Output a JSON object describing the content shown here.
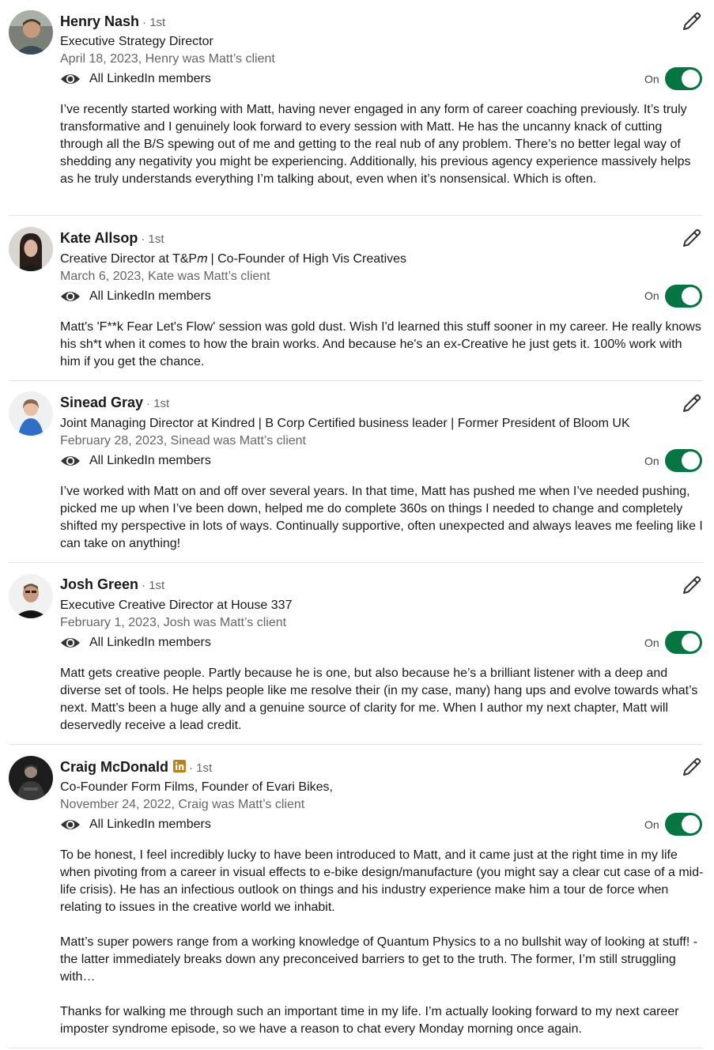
{
  "colors": {
    "toggle_on": "#057642",
    "divider": "#e3e3e3",
    "secondary_text": "#666666",
    "linkedin_badge": "#c37d16"
  },
  "recommendations": [
    {
      "name": "Henry Nash",
      "degree": "· 1st",
      "headline": "Executive Strategy Director",
      "date": "April 18, 2023, Henry was Matt’s client",
      "visibility": "All LinkedIn members",
      "toggle_label": "On",
      "toggle_state": true,
      "paragraphs": [
        " I’ve recently started working with Matt, having never engaged in any form of career coaching previously. It’s truly transformative and I genuinely look forward to every session with Matt. He has the uncanny knack of cutting through all the B/S spewing out of me and getting to the real nub of any problem. There’s no better legal way of shedding any negativity you might be experiencing. Additionally, his previous agency experience massively helps as he truly understands everything I’m talking about, even when it’s nonsensical. Which is often."
      ]
    },
    {
      "name": "Kate Allsop",
      "degree": "· 1st",
      "headline": "Creative Director at T&P𝑚 | Co-Founder of High Vis Creatives",
      "date": "March 6, 2023, Kate was Matt’s client",
      "visibility": "All LinkedIn members",
      "toggle_label": "On",
      "toggle_state": true,
      "paragraphs": [
        "Matt's 'F**k Fear Let's Flow' session was gold dust. Wish I'd learned this stuff sooner in my career. He really knows his sh*t when it comes to how the brain works. And because he's an ex-Creative he just gets it. 100% work with him if you get the chance."
      ]
    },
    {
      "name": "Sinead Gray",
      "degree": "· 1st",
      "headline": "Joint Managing Director at Kindred | B Corp Certified business leader | Former President of Bloom UK",
      "date": "February 28, 2023, Sinead was Matt’s client",
      "visibility": "All LinkedIn members",
      "toggle_label": "On",
      "toggle_state": true,
      "paragraphs": [
        "I’ve worked with Matt on and off over several years. In that time, Matt has pushed me when I’ve needed pushing, picked me up when I’ve been down, helped me do complete 360s on things I needed to change and completely shifted my perspective in lots of ways. Continually supportive, often unexpected and always leaves me feeling like I can take on anything!"
      ]
    },
    {
      "name": "Josh Green",
      "degree": "· 1st",
      "headline": "Executive Creative Director at House 337",
      "date": "February 1, 2023, Josh was Matt’s client",
      "visibility": "All LinkedIn members",
      "toggle_label": "On",
      "toggle_state": true,
      "paragraphs": [
        "Matt gets creative people. Partly because he is one, but also because he’s a brilliant listener with a deep and diverse set of tools. He helps people like me resolve their (in my case, many) hang ups and evolve towards what’s next. Matt’s been a huge ally and a genuine source of clarity for me. When I author my next chapter, Matt will deservedly receive a lead credit."
      ]
    },
    {
      "name": "Craig McDonald",
      "degree": "· 1st",
      "has_linkedin_badge": true,
      "headline": "Co-Founder Form Films, Founder of Evari Bikes,",
      "date": "November 24, 2022, Craig was Matt’s client",
      "visibility": "All LinkedIn members",
      "toggle_label": "On",
      "toggle_state": true,
      "paragraphs": [
        "To be honest, I feel incredibly lucky to have been introduced to Matt, and it came just at the right time in my life when pivoting from a career in visual effects to e-bike design/manufacture (you might say a clear cut case of a mid-life crisis). He has an infectious outlook on things and his industry experience make him a tour de force when relating to issues in the creative world we inhabit.",
        "Matt’s super powers range from a working knowledge of Quantum Physics to a no bullshit way of looking at stuff! - the latter immediately breaks down any preconceived barriers to get to the truth. The former, I’m still struggling with…",
        "Thanks for walking me through such an important time in my life. I’m actually looking forward to my next career imposter syndrome episode, so we have a reason to chat every Monday morning once again."
      ]
    }
  ]
}
